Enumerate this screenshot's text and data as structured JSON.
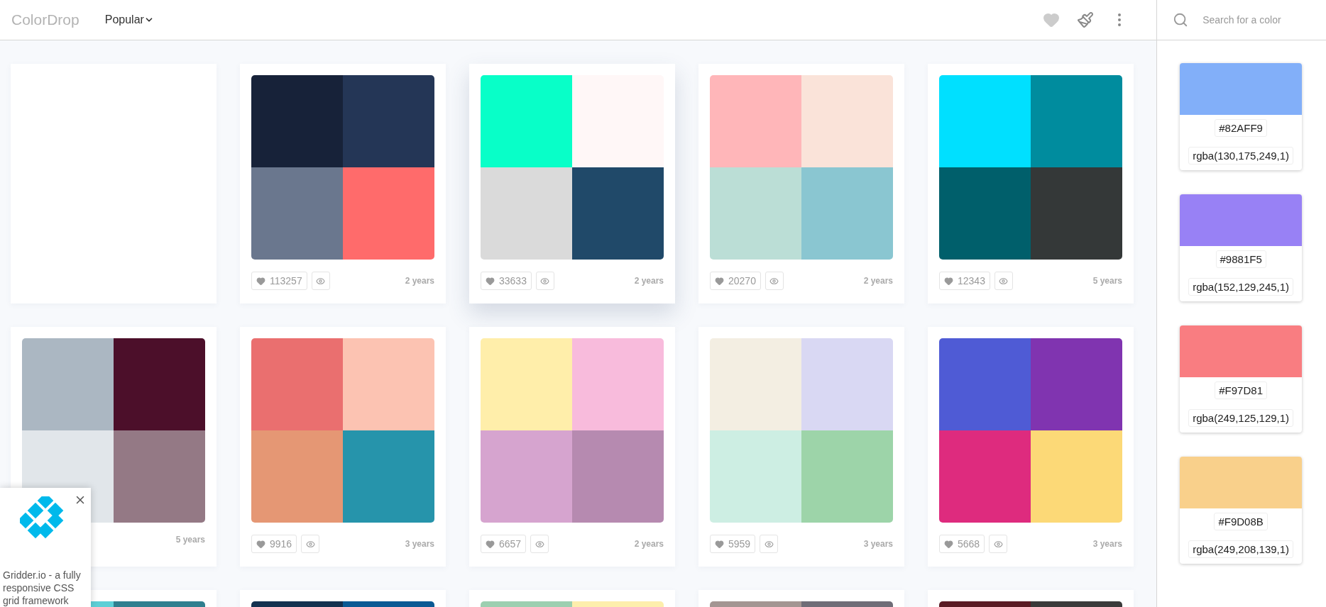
{
  "header": {
    "logo": "ColorDrop",
    "sort": "Popular",
    "search": {
      "placeholder": "Search for a color"
    }
  },
  "palettes": [
    {
      "raised": false
    },
    {
      "raised": false,
      "swatches": [
        {
          "color": "#172239"
        },
        {
          "color": "#243656"
        },
        {
          "color": "#6a778e"
        },
        {
          "color": "#ff6b6b"
        }
      ],
      "likes": "113257",
      "age": "2 years"
    },
    {
      "raised": true,
      "swatches": [
        {
          "color": "#08ffc8"
        },
        {
          "color": "#fff7f7"
        },
        {
          "color": "#dadada"
        },
        {
          "color": "#204969"
        }
      ],
      "likes": "33633",
      "age": "2 years"
    },
    {
      "raised": false,
      "swatches": [
        {
          "color": "#ffb6b9"
        },
        {
          "color": "#fae3d9"
        },
        {
          "color": "#bbded6"
        },
        {
          "color": "#8ac6d1"
        }
      ],
      "likes": "20270",
      "age": "2 years"
    },
    {
      "raised": false,
      "swatches": [
        {
          "color": "#00e0ff"
        },
        {
          "color": "#008c9e"
        },
        {
          "color": "#005f6b"
        },
        {
          "color": "#343838"
        }
      ],
      "likes": "12343",
      "age": "5 years"
    },
    {
      "raised": false,
      "swatches": [
        {
          "color": "#abb7c2"
        },
        {
          "color": "#4c0f2a"
        },
        {
          "color": "#e1e6ea"
        },
        {
          "color": "#947985"
        }
      ],
      "age": "5 years"
    },
    {
      "raised": false,
      "swatches": [
        {
          "color": "#ea6f6f"
        },
        {
          "color": "#fcc3b2"
        },
        {
          "color": "#e59774"
        },
        {
          "color": "#2694ab"
        }
      ],
      "likes": "9916",
      "age": "3 years"
    },
    {
      "raised": false,
      "swatches": [
        {
          "color": "#ffeeaa"
        },
        {
          "color": "#f8bbdc"
        },
        {
          "color": "#d6a4cf"
        },
        {
          "color": "#b68ab0"
        }
      ],
      "likes": "6657",
      "age": "2 years"
    },
    {
      "raised": false,
      "swatches": [
        {
          "color": "#f3eee2"
        },
        {
          "color": "#d9d8f3"
        },
        {
          "color": "#cdeee3"
        },
        {
          "color": "#9dd4a9"
        }
      ],
      "likes": "5959",
      "age": "3 years"
    },
    {
      "raised": false,
      "swatches": [
        {
          "color": "#4f5bd5"
        },
        {
          "color": "#8034b0"
        },
        {
          "color": "#de2b7e"
        },
        {
          "color": "#fcd977"
        }
      ],
      "likes": "5668",
      "age": "3 years"
    },
    {
      "swatches": [
        {
          "color": "#5ccfd6"
        },
        {
          "color": "#2f7f8f"
        }
      ]
    },
    {
      "swatches": [
        {
          "color": "#13314f"
        },
        {
          "color": "#0a5a94"
        }
      ]
    },
    {
      "swatches": [
        {
          "color": "#9ccfb0"
        },
        {
          "color": "#fdeeac"
        }
      ]
    },
    {
      "swatches": [
        {
          "color": "#a39592"
        },
        {
          "color": "#6f6d77"
        }
      ]
    },
    {
      "swatches": [
        {
          "color": "#5a1b24"
        },
        {
          "color": "#3a3a3a"
        }
      ]
    }
  ],
  "sidebar_colors": [
    {
      "color": "#82aff9",
      "hex": "#82AFF9",
      "rgba": "rgba(130,175,249,1)"
    },
    {
      "color": "#9881f5",
      "hex": "#9881F5",
      "rgba": "rgba(152,129,245,1)"
    },
    {
      "color": "#f97d81",
      "hex": "#F97D81",
      "rgba": "rgba(249,125,129,1)"
    },
    {
      "color": "#f9d08b",
      "hex": "#F9D08B",
      "rgba": "rgba(249,208,139,1)"
    }
  ],
  "ad": {
    "text": "Gridder.io - a fully responsive CSS grid framework"
  }
}
